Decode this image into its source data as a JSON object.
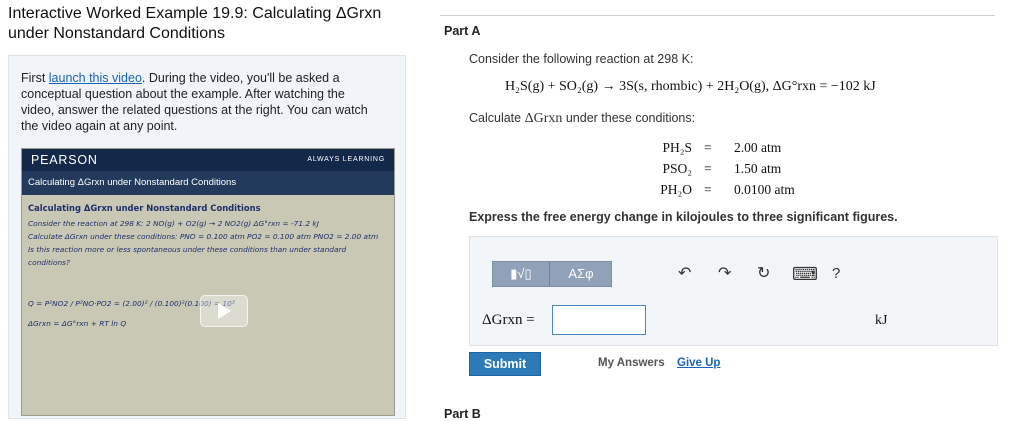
{
  "title": "Interactive Worked Example 19.9: Calculating ΔGrxn under Nonstandard Conditions",
  "intro": {
    "before_link": "First ",
    "link": "launch this video",
    "after_link": ". During the video, you'll be asked a conceptual question about the example. After watching the video, answer the related questions at the right. You can watch the video again at any point."
  },
  "video": {
    "brand": "PEARSON",
    "tagline": "ALWAYS LEARNING",
    "subtitle": "Calculating ΔGrxn under Nonstandard Conditions",
    "board": {
      "heading": "Calculating ΔGrxn under Nonstandard Conditions",
      "line1": "Consider the reaction at 298 K: 2 NO(g) + O2(g) → 2 NO2(g)   ΔG°rxn = -71.2 kJ",
      "line2": "Calculate ΔGrxn under these conditions: PNO = 0.100 atm PO2 = 0.100 atm PNO2 = 2.00 atm",
      "line3": "Is this reaction more or less spontaneous under these conditions than under standard",
      "line4": "conditions?",
      "q_line": "Q = P²NO2 / P²NO·PO2 = (2.00)² / (0.100)²(0.100) = 10³",
      "dg_line": "ΔGrxn = ΔG°rxn + RT ln Q"
    }
  },
  "part_a": {
    "label": "Part A",
    "prompt": "Consider the following reaction at 298 K:",
    "reaction": "H₂S(g) + SO₂(g) → 3S(s, rhombic) + 2H₂O(g),   ΔG°rxn = −102 kJ",
    "calc_prompt_before": "Calculate ",
    "calc_symbol": "ΔGrxn",
    "calc_prompt_after": " under these conditions:",
    "conditions": [
      {
        "symbol": "PH₂S",
        "eq": "=",
        "value": "2.00 atm"
      },
      {
        "symbol": "PSO₂",
        "eq": "=",
        "value": "1.50 atm"
      },
      {
        "symbol": "PH₂O",
        "eq": "=",
        "value": "0.0100 atm"
      }
    ],
    "instruction": "Express the free energy change in kilojoules to three significant figures.",
    "toolbar": {
      "template_label": "▮√▯",
      "greek_label": "ΑΣφ",
      "undo_icon": "↶",
      "redo_icon": "↷",
      "reset_icon": "↻",
      "keyboard_icon": "⌨",
      "help_label": "?"
    },
    "answer_label": "ΔGrxn =",
    "answer_value": "",
    "unit": "kJ",
    "submit_label": "Submit",
    "my_answers_label": "My Answers",
    "give_up_label": "Give Up"
  },
  "part_b": {
    "label": "Part B"
  }
}
